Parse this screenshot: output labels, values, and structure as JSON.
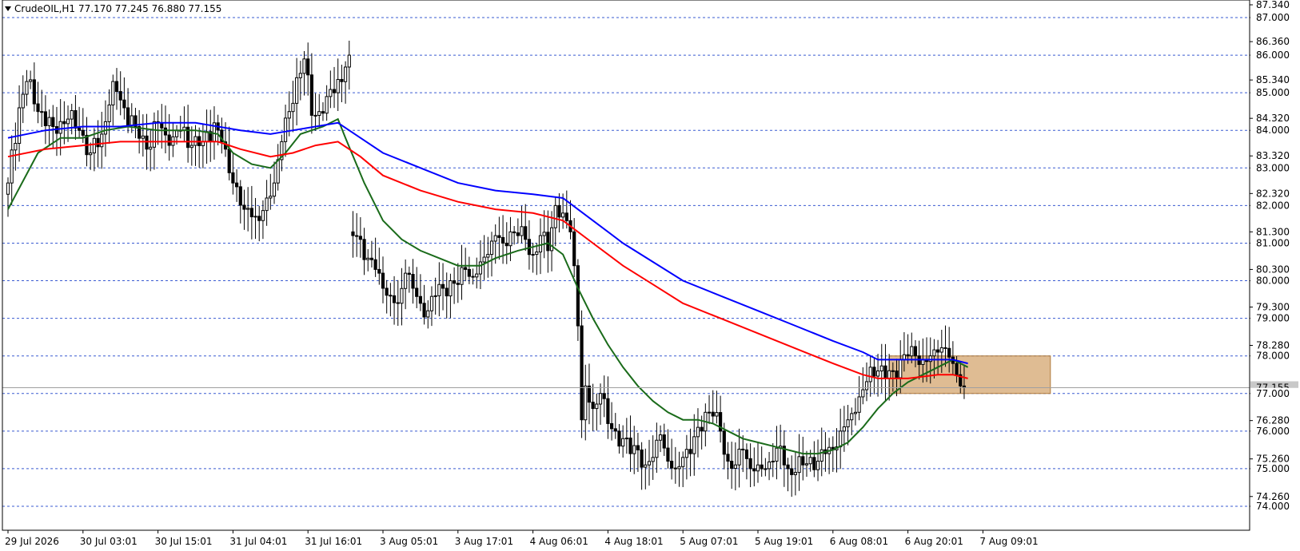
{
  "header": {
    "symbol_label": "CrudeOIL,H1",
    "ohlc_label": "77.170 77.245 76.880 77.155",
    "dropdown_icon": "triangle-down-icon"
  },
  "colors": {
    "grid": "#3a5bd1",
    "ma_fast": "#1a6b1a",
    "ma_mid": "#ff0000",
    "ma_slow": "#0000ff",
    "zone": "#d2a065",
    "bull": "#ffffff",
    "bear": "#000000",
    "price_line": "#a0a0a0"
  },
  "chart_data": {
    "type": "candlestick",
    "instrument": "CrudeOIL",
    "timeframe": "H1",
    "ylim": [
      74.0,
      87.34
    ],
    "y_ticks": [
      {
        "value": 87.34,
        "label": "87.340",
        "grid": false
      },
      {
        "value": 87.0,
        "label": "87.000",
        "grid": true
      },
      {
        "value": 86.36,
        "label": "86.360",
        "grid": false
      },
      {
        "value": 86.0,
        "label": "86.000",
        "grid": true
      },
      {
        "value": 85.34,
        "label": "85.340",
        "grid": false
      },
      {
        "value": 85.0,
        "label": "85.000",
        "grid": true
      },
      {
        "value": 84.32,
        "label": "84.320",
        "grid": false
      },
      {
        "value": 84.0,
        "label": "84.000",
        "grid": true
      },
      {
        "value": 83.32,
        "label": "83.320",
        "grid": false
      },
      {
        "value": 83.0,
        "label": "83.000",
        "grid": true
      },
      {
        "value": 82.32,
        "label": "82.320",
        "grid": false
      },
      {
        "value": 82.0,
        "label": "82.000",
        "grid": true
      },
      {
        "value": 81.3,
        "label": "81.300",
        "grid": false
      },
      {
        "value": 81.0,
        "label": "81.000",
        "grid": true
      },
      {
        "value": 80.3,
        "label": "80.300",
        "grid": false
      },
      {
        "value": 80.0,
        "label": "80.000",
        "grid": true
      },
      {
        "value": 79.3,
        "label": "79.300",
        "grid": false
      },
      {
        "value": 79.0,
        "label": "79.000",
        "grid": true
      },
      {
        "value": 78.28,
        "label": "78.280",
        "grid": false
      },
      {
        "value": 78.0,
        "label": "78.000",
        "grid": true
      },
      {
        "value": 77.0,
        "label": "77.000",
        "grid": true
      },
      {
        "value": 76.28,
        "label": "76.280",
        "grid": false
      },
      {
        "value": 76.0,
        "label": "76.000",
        "grid": true
      },
      {
        "value": 75.26,
        "label": "75.260",
        "grid": false
      },
      {
        "value": 75.0,
        "label": "75.000",
        "grid": true
      },
      {
        "value": 74.26,
        "label": "74.260",
        "grid": false
      },
      {
        "value": 74.0,
        "label": "74.000",
        "grid": true
      }
    ],
    "current_price": 77.155,
    "current_price_label": "77.155",
    "x_labels": [
      {
        "bar": 0,
        "label": "29 Jul 2026"
      },
      {
        "bar": 20,
        "label": "30 Jul 03:01"
      },
      {
        "bar": 40,
        "label": "30 Jul 15:01"
      },
      {
        "bar": 60,
        "label": "31 Jul 04:01"
      },
      {
        "bar": 80,
        "label": "31 Jul 16:01"
      },
      {
        "bar": 100,
        "label": "3 Aug 05:01"
      },
      {
        "bar": 120,
        "label": "3 Aug 17:01"
      },
      {
        "bar": 140,
        "label": "4 Aug 06:01"
      },
      {
        "bar": 160,
        "label": "4 Aug 18:01"
      },
      {
        "bar": 180,
        "label": "5 Aug 07:01"
      },
      {
        "bar": 200,
        "label": "5 Aug 19:01"
      },
      {
        "bar": 220,
        "label": "6 Aug 08:01"
      },
      {
        "bar": 240,
        "label": "6 Aug 20:01"
      },
      {
        "bar": 260,
        "label": "7 Aug 09:01"
      }
    ],
    "zone": {
      "from_bar": 235,
      "to_bar": 278,
      "low": 77.0,
      "high": 78.0
    },
    "anchor_closes": [
      [
        0,
        82.6
      ],
      [
        3,
        84.6
      ],
      [
        5,
        85.3
      ],
      [
        8,
        84.5
      ],
      [
        12,
        84.1
      ],
      [
        16,
        84.3
      ],
      [
        19,
        84.0
      ],
      [
        22,
        83.4
      ],
      [
        25,
        83.9
      ],
      [
        28,
        85.3
      ],
      [
        31,
        84.6
      ],
      [
        34,
        84.1
      ],
      [
        37,
        83.5
      ],
      [
        40,
        84.2
      ],
      [
        43,
        83.6
      ],
      [
        46,
        84.0
      ],
      [
        49,
        83.6
      ],
      [
        52,
        83.7
      ],
      [
        55,
        84.2
      ],
      [
        58,
        83.5
      ],
      [
        60,
        82.6
      ],
      [
        63,
        81.9
      ],
      [
        65,
        81.7
      ],
      [
        67,
        81.6
      ],
      [
        69,
        82.2
      ],
      [
        71,
        82.6
      ],
      [
        73,
        83.7
      ],
      [
        75,
        84.5
      ],
      [
        77,
        85.4
      ],
      [
        79,
        85.9
      ],
      [
        81,
        84.4
      ],
      [
        83,
        84.5
      ],
      [
        85,
        84.9
      ],
      [
        87,
        85.0
      ],
      [
        91,
        86.0
      ],
      [
        92,
        81.2
      ],
      [
        94,
        81.1
      ],
      [
        96,
        80.6
      ],
      [
        98,
        80.3
      ],
      [
        100,
        79.8
      ],
      [
        102,
        79.6
      ],
      [
        104,
        79.4
      ],
      [
        106,
        80.2
      ],
      [
        108,
        79.8
      ],
      [
        110,
        79.4
      ],
      [
        112,
        79.2
      ],
      [
        114,
        79.6
      ],
      [
        116,
        79.8
      ],
      [
        118,
        80.0
      ],
      [
        120,
        79.9
      ],
      [
        122,
        80.3
      ],
      [
        124,
        80.1
      ],
      [
        126,
        80.5
      ],
      [
        128,
        80.7
      ],
      [
        130,
        81.2
      ],
      [
        132,
        81.0
      ],
      [
        134,
        81.3
      ],
      [
        136,
        81.2
      ],
      [
        138,
        81.1
      ],
      [
        140,
        80.7
      ],
      [
        142,
        81.2
      ],
      [
        144,
        80.8
      ],
      [
        146,
        82.0
      ],
      [
        148,
        81.8
      ],
      [
        150,
        81.3
      ],
      [
        151,
        80.4
      ],
      [
        152,
        78.8
      ],
      [
        153,
        76.3
      ],
      [
        154,
        77.2
      ],
      [
        156,
        76.6
      ],
      [
        158,
        77.0
      ],
      [
        160,
        76.2
      ],
      [
        162,
        76.0
      ],
      [
        164,
        75.8
      ],
      [
        166,
        75.4
      ],
      [
        168,
        75.5
      ],
      [
        170,
        75.1
      ],
      [
        172,
        75.3
      ],
      [
        174,
        75.9
      ],
      [
        176,
        75.2
      ],
      [
        178,
        75.0
      ],
      [
        180,
        75.3
      ],
      [
        182,
        75.4
      ],
      [
        184,
        76.1
      ],
      [
        186,
        76.5
      ],
      [
        188,
        76.4
      ],
      [
        190,
        76.0
      ],
      [
        192,
        75.2
      ],
      [
        194,
        75.1
      ],
      [
        196,
        75.5
      ],
      [
        198,
        75.0
      ],
      [
        200,
        75.1
      ],
      [
        202,
        75.0
      ],
      [
        204,
        75.2
      ],
      [
        206,
        75.6
      ],
      [
        208,
        75.0
      ],
      [
        210,
        74.9
      ],
      [
        212,
        75.1
      ],
      [
        214,
        75.3
      ],
      [
        216,
        75.2
      ],
      [
        218,
        75.4
      ],
      [
        220,
        75.5
      ],
      [
        222,
        76.0
      ],
      [
        224,
        76.3
      ],
      [
        226,
        76.5
      ],
      [
        228,
        77.1
      ],
      [
        230,
        77.7
      ],
      [
        232,
        77.6
      ],
      [
        234,
        77.4
      ],
      [
        236,
        77.6
      ],
      [
        238,
        77.9
      ],
      [
        240,
        78.0
      ],
      [
        242,
        78.0
      ],
      [
        244,
        77.9
      ],
      [
        246,
        78.0
      ],
      [
        248,
        78.1
      ],
      [
        250,
        78.2
      ],
      [
        252,
        77.8
      ],
      [
        253,
        77.5
      ],
      [
        254,
        77.2
      ],
      [
        255,
        77.155
      ]
    ],
    "series": [
      {
        "name": "MA fast",
        "color": "#1a6b1a",
        "points": [
          [
            0,
            81.9
          ],
          [
            8,
            83.4
          ],
          [
            14,
            83.8
          ],
          [
            20,
            83.8
          ],
          [
            26,
            84.0
          ],
          [
            32,
            84.1
          ],
          [
            40,
            84.0
          ],
          [
            50,
            84.0
          ],
          [
            56,
            83.9
          ],
          [
            60,
            83.4
          ],
          [
            65,
            83.1
          ],
          [
            70,
            83.0
          ],
          [
            74,
            83.4
          ],
          [
            78,
            83.9
          ],
          [
            84,
            84.1
          ],
          [
            88,
            84.3
          ],
          [
            90,
            83.8
          ],
          [
            95,
            82.6
          ],
          [
            100,
            81.6
          ],
          [
            105,
            81.1
          ],
          [
            110,
            80.8
          ],
          [
            115,
            80.6
          ],
          [
            120,
            80.4
          ],
          [
            126,
            80.4
          ],
          [
            130,
            80.6
          ],
          [
            136,
            80.8
          ],
          [
            140,
            80.9
          ],
          [
            144,
            81.0
          ],
          [
            148,
            80.7
          ],
          [
            152,
            79.8
          ],
          [
            156,
            79.0
          ],
          [
            160,
            78.3
          ],
          [
            164,
            77.7
          ],
          [
            168,
            77.2
          ],
          [
            172,
            76.8
          ],
          [
            176,
            76.5
          ],
          [
            180,
            76.3
          ],
          [
            184,
            76.3
          ],
          [
            188,
            76.2
          ],
          [
            192,
            76.0
          ],
          [
            196,
            75.8
          ],
          [
            200,
            75.7
          ],
          [
            204,
            75.6
          ],
          [
            208,
            75.5
          ],
          [
            212,
            75.4
          ],
          [
            216,
            75.4
          ],
          [
            220,
            75.5
          ],
          [
            224,
            75.7
          ],
          [
            228,
            76.1
          ],
          [
            232,
            76.6
          ],
          [
            236,
            77.0
          ],
          [
            240,
            77.3
          ],
          [
            244,
            77.5
          ],
          [
            248,
            77.7
          ],
          [
            252,
            77.9
          ],
          [
            256,
            77.7
          ]
        ]
      },
      {
        "name": "MA mid",
        "color": "#ff0000",
        "points": [
          [
            0,
            83.3
          ],
          [
            10,
            83.5
          ],
          [
            20,
            83.6
          ],
          [
            30,
            83.7
          ],
          [
            40,
            83.7
          ],
          [
            50,
            83.7
          ],
          [
            56,
            83.7
          ],
          [
            62,
            83.5
          ],
          [
            70,
            83.3
          ],
          [
            76,
            83.4
          ],
          [
            82,
            83.6
          ],
          [
            88,
            83.7
          ],
          [
            94,
            83.3
          ],
          [
            100,
            82.8
          ],
          [
            110,
            82.4
          ],
          [
            120,
            82.1
          ],
          [
            130,
            81.9
          ],
          [
            140,
            81.8
          ],
          [
            148,
            81.6
          ],
          [
            156,
            81.0
          ],
          [
            164,
            80.4
          ],
          [
            172,
            79.9
          ],
          [
            180,
            79.4
          ],
          [
            190,
            79.0
          ],
          [
            200,
            78.6
          ],
          [
            210,
            78.2
          ],
          [
            220,
            77.8
          ],
          [
            228,
            77.5
          ],
          [
            232,
            77.4
          ],
          [
            240,
            77.4
          ],
          [
            248,
            77.5
          ],
          [
            252,
            77.5
          ],
          [
            256,
            77.4
          ]
        ]
      },
      {
        "name": "MA slow",
        "color": "#0000ff",
        "points": [
          [
            0,
            83.8
          ],
          [
            10,
            84.0
          ],
          [
            20,
            84.1
          ],
          [
            30,
            84.1
          ],
          [
            40,
            84.2
          ],
          [
            50,
            84.2
          ],
          [
            56,
            84.1
          ],
          [
            62,
            84.0
          ],
          [
            70,
            83.9
          ],
          [
            76,
            84.0
          ],
          [
            82,
            84.1
          ],
          [
            88,
            84.2
          ],
          [
            94,
            83.8
          ],
          [
            100,
            83.4
          ],
          [
            110,
            83.0
          ],
          [
            120,
            82.6
          ],
          [
            130,
            82.4
          ],
          [
            140,
            82.3
          ],
          [
            148,
            82.2
          ],
          [
            156,
            81.6
          ],
          [
            164,
            81.0
          ],
          [
            172,
            80.5
          ],
          [
            180,
            80.0
          ],
          [
            190,
            79.6
          ],
          [
            200,
            79.2
          ],
          [
            210,
            78.8
          ],
          [
            220,
            78.4
          ],
          [
            228,
            78.1
          ],
          [
            232,
            77.9
          ],
          [
            240,
            77.9
          ],
          [
            248,
            77.9
          ],
          [
            252,
            77.9
          ],
          [
            256,
            77.8
          ]
        ]
      }
    ]
  }
}
